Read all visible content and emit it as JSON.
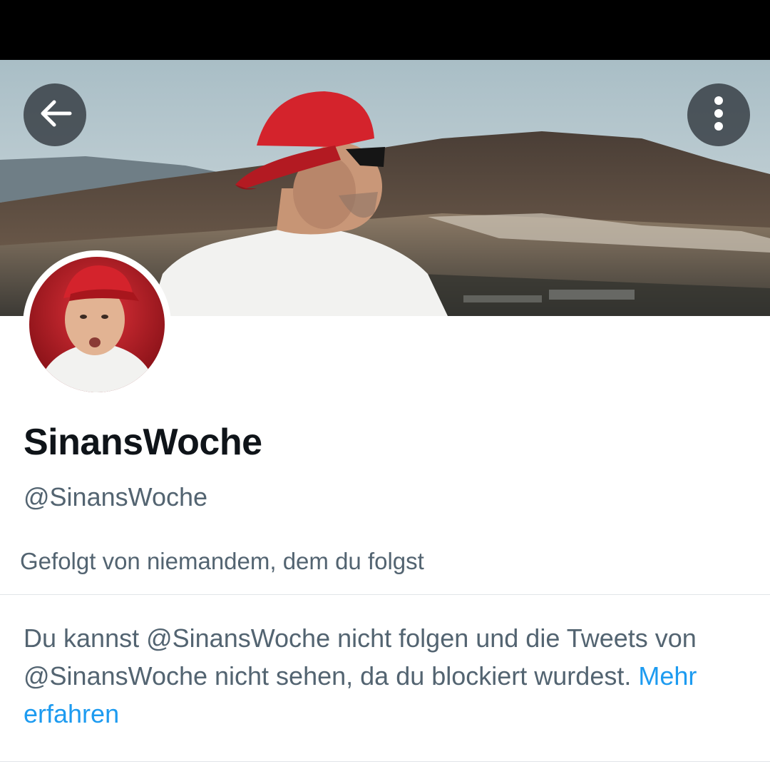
{
  "header": {
    "back_icon": "arrow-left-icon",
    "more_icon": "more-vertical-icon"
  },
  "profile": {
    "display_name": "SinansWoche",
    "handle": "@SinansWoche",
    "followed_by": "Gefolgt von niemandem, dem du folgst"
  },
  "blocked_notice": {
    "text": "Du kannst @SinansWoche nicht folgen und die Tweets von @SinansWoche nicht sehen, da du blockiert wurdest.",
    "link_label": "Mehr erfahren"
  },
  "colors": {
    "primary_text": "#0f1419",
    "secondary_text": "#536471",
    "link": "#1d9bf0",
    "divider": "#e1e5e8"
  }
}
